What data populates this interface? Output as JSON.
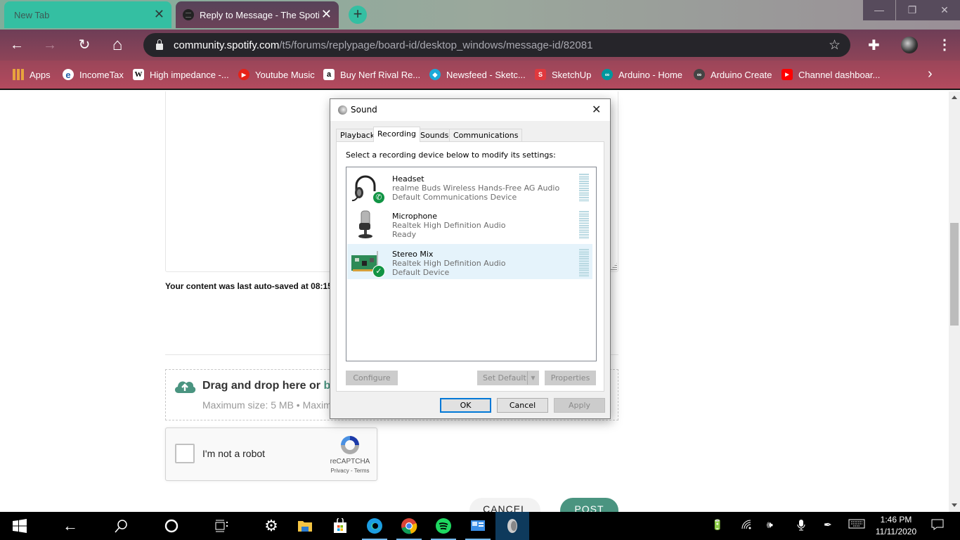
{
  "browser": {
    "tabs": [
      {
        "title": "New Tab",
        "active": false
      },
      {
        "title": "Reply to Message - The Spotify",
        "active": true
      }
    ],
    "new_tab_label": "+",
    "window_controls": {
      "minimize": "—",
      "restore": "❐",
      "close": "✕"
    },
    "nav": {
      "back": "←",
      "forward": "→",
      "reload": "↻",
      "home": "⌂"
    },
    "url": {
      "host": "community.spotify.com",
      "path": "/t5/forums/replypage/board-id/desktop_windows/message-id/82081"
    },
    "bookmarks": [
      {
        "label": "Apps",
        "icon": "apps-grid-icon",
        "color": "#e8a33d"
      },
      {
        "label": "IncomeTax",
        "icon": "ie-icon",
        "color": "#1f5fa8"
      },
      {
        "label": "High impedance -...",
        "icon": "wikipedia-icon",
        "color": "#ffffff"
      },
      {
        "label": "Youtube Music",
        "icon": "youtube-music-icon",
        "color": "#e62117"
      },
      {
        "label": "Buy Nerf Rival Re...",
        "icon": "amazon-icon",
        "color": "#ffffff"
      },
      {
        "label": "Newsfeed - Sketc...",
        "icon": "sketchfab-icon",
        "color": "#1caad9"
      },
      {
        "label": "SketchUp",
        "icon": "sketchup-icon",
        "color": "#e0393e"
      },
      {
        "label": "Arduino - Home",
        "icon": "arduino-icon",
        "color": "#00979d"
      },
      {
        "label": "Arduino Create",
        "icon": "arduino-create-icon",
        "color": "#444444"
      },
      {
        "label": "Channel dashboar...",
        "icon": "youtube-icon",
        "color": "#ff0000"
      }
    ]
  },
  "page": {
    "autosave_text": "Your content was last auto-saved at 08:15",
    "dropzone": {
      "title": "Drag and drop here or ",
      "browse": "b",
      "subtitle": "Maximum size: 5 MB • Maxim"
    },
    "recaptcha": {
      "label": "I'm not a robot",
      "brand": "reCAPTCHA",
      "links": "Privacy - Terms"
    },
    "cancel_label": "CANCEL",
    "post_label": "POST"
  },
  "dialog": {
    "title": "Sound",
    "close": "✕",
    "tabs": [
      "Playback",
      "Recording",
      "Sounds",
      "Communications"
    ],
    "active_tab": "Recording",
    "instruction": "Select a recording device below to modify its settings:",
    "devices": [
      {
        "name": "Headset",
        "driver": "realme Buds Wireless Hands-Free AG Audio",
        "status": "Default Communications Device",
        "badge": "phone",
        "selected": false
      },
      {
        "name": "Microphone",
        "driver": "Realtek High Definition Audio",
        "status": "Ready",
        "badge": "",
        "selected": false
      },
      {
        "name": "Stereo Mix",
        "driver": "Realtek High Definition Audio",
        "status": "Default Device",
        "badge": "check",
        "selected": true
      }
    ],
    "buttons": {
      "configure": "Configure",
      "set_default": "Set Default",
      "properties": "Properties",
      "ok": "OK",
      "cancel": "Cancel",
      "apply": "Apply"
    }
  },
  "taskbar": {
    "clock_time": "1:46 PM",
    "clock_date": "11/11/2020",
    "apps": [
      "start",
      "back",
      "search",
      "cortana",
      "task-view",
      "settings",
      "file-explorer",
      "store",
      "edge",
      "chrome",
      "spotify",
      "control-panel",
      "sound"
    ]
  },
  "colors": {
    "accent_green": "#4a9480",
    "tab_teal": "#34bfa2",
    "selection": "#e5f3fb",
    "ok_border": "#0078d7"
  }
}
